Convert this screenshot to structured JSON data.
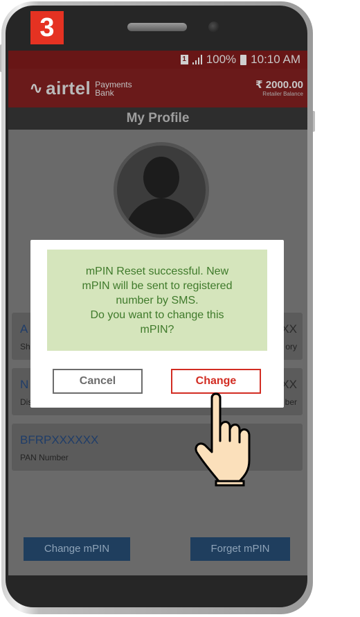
{
  "step": {
    "number": "3",
    "color": "#e53222"
  },
  "status_bar": {
    "sim_label": "1",
    "battery": "100%",
    "time": "10:10 AM"
  },
  "app_bar": {
    "brand": "airtel",
    "brand_sub_line1": "Payments",
    "brand_sub_line2": "Bank",
    "balance_value": "₹ 2000.00",
    "balance_label": "Retailer Balance"
  },
  "screen_title": "My Profile",
  "profile_cards": [
    {
      "value_partial": "A",
      "value_tail": "XX",
      "label_partial": "Sh",
      "label_tail": "ory"
    },
    {
      "value_partial": "N",
      "value_tail": "XX",
      "label_partial": "Dis",
      "label_tail": "ber"
    },
    {
      "value": "BFRPXXXXXX",
      "label": "PAN Number"
    }
  ],
  "bottom_buttons": {
    "change_mpin": "Change mPIN",
    "forget_mpin": "Forget mPIN"
  },
  "dialog": {
    "message": "mPIN Reset successful. New\nmPIN will be sent to registered\nnumber by SMS.\nDo you want to change this\nmPIN?",
    "cancel_label": "Cancel",
    "change_label": "Change"
  },
  "colors": {
    "accent_red": "#d22c22",
    "message_green": "#3f7a2b",
    "message_bg": "#d5e5bc"
  },
  "icons": [
    "sim-icon",
    "signal-icon",
    "battery-icon",
    "airtel-logo-icon",
    "avatar-icon",
    "pointing-hand-icon"
  ]
}
